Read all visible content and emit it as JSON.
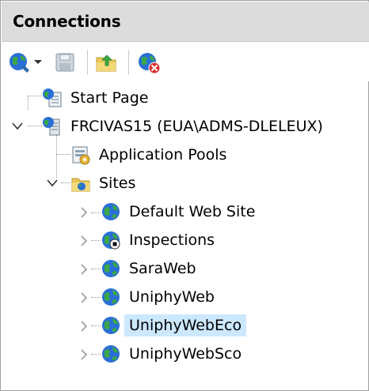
{
  "header": {
    "title": "Connections"
  },
  "tree": {
    "start_page": "Start Page",
    "server": "FRCIVAS15 (EUA\\ADMS-DLELEUX)",
    "app_pools": "Application Pools",
    "sites": "Sites",
    "site_items": [
      {
        "label": "Default Web Site"
      },
      {
        "label": "Inspections"
      },
      {
        "label": "SaraWeb"
      },
      {
        "label": "UniphyWeb"
      },
      {
        "label": "UniphyWebEco",
        "selected": true
      },
      {
        "label": "UniphyWebSco"
      }
    ]
  },
  "colors": {
    "header_bg": "#dcdcdc",
    "selection_bg": "#cce8ff",
    "globe_blue": "#2a6fd6",
    "globe_green": "#3aa845"
  }
}
